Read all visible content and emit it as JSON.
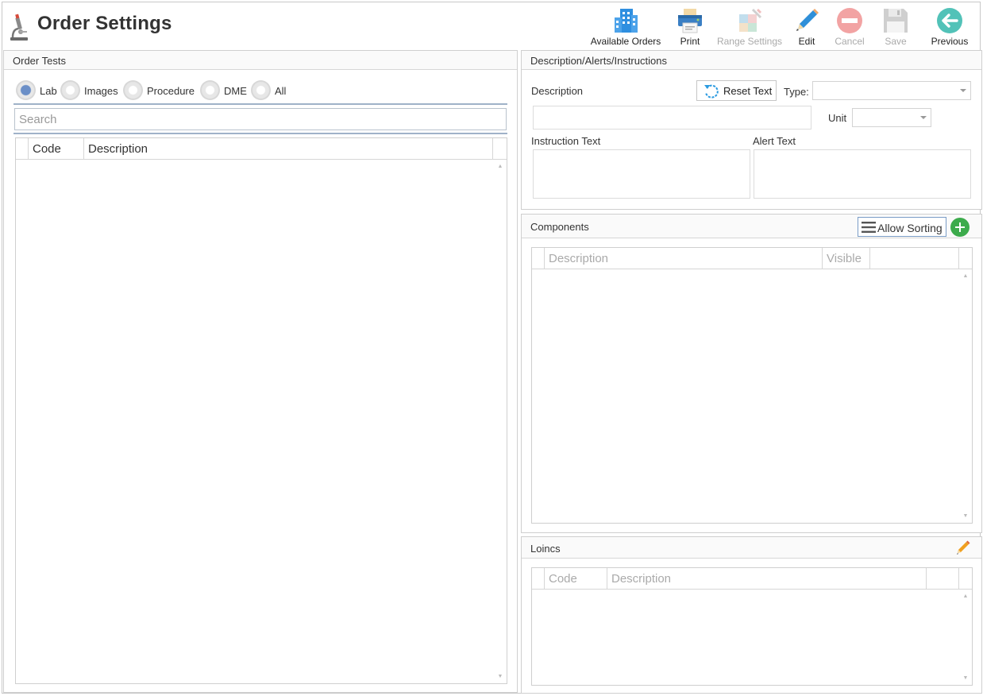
{
  "header": {
    "title": "Order Settings"
  },
  "toolbar": {
    "available_orders": "Available Orders",
    "print": "Print",
    "range_settings": "Range Settings",
    "edit": "Edit",
    "cancel": "Cancel",
    "save": "Save",
    "previous": "Previous"
  },
  "order_tests": {
    "title": "Order Tests",
    "radios": [
      "Lab",
      "Images",
      "Procedure",
      "DME",
      "All"
    ],
    "selected": "Lab",
    "search_placeholder": "Search",
    "grid_headers": [
      "Code",
      "Description"
    ]
  },
  "description_panel": {
    "title": "Description/Alerts/Instructions",
    "description_label": "Description",
    "reset_text": "Reset Text",
    "type_label": "Type:",
    "type_value": "",
    "unit_label": "Unit",
    "unit_value": "",
    "instruction_label": "Instruction Text",
    "alert_label": "Alert Text"
  },
  "components": {
    "title": "Components",
    "allow_sorting": "Allow Sorting",
    "grid_headers": [
      "Description",
      "Visible"
    ]
  },
  "loincs": {
    "title": "Loincs",
    "grid_headers": [
      "Code",
      "Description"
    ]
  },
  "colors": {
    "radio_selected": "#6b8fc7",
    "add_button": "#3cab4c",
    "disabled_text": "#aaaaaa",
    "panel_border": "#cfcfcf"
  }
}
